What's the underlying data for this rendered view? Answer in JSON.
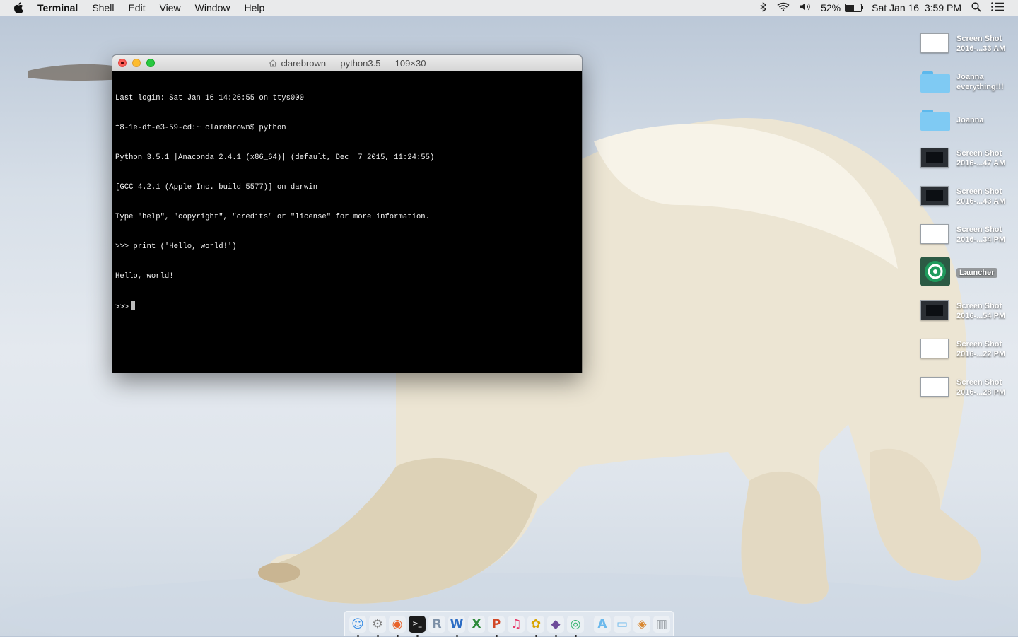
{
  "menubar": {
    "app_name": "Terminal",
    "menus": [
      "Shell",
      "Edit",
      "View",
      "Window",
      "Help"
    ],
    "battery_percent": "52%",
    "battery_level": 0.52,
    "datetime": "Sat Jan 16  3:59 PM",
    "icons": [
      "apple-icon",
      "bluetooth-icon",
      "wifi-icon",
      "volume-icon",
      "battery-icon",
      "spotlight-icon",
      "notification-center-icon"
    ]
  },
  "terminal": {
    "title": "clarebrown — python3.5 — 109×30",
    "lines": [
      "Last login: Sat Jan 16 14:26:55 on ttys000",
      "f8-1e-df-e3-59-cd:~ clarebrown$ python",
      "Python 3.5.1 |Anaconda 2.4.1 (x86_64)| (default, Dec  7 2015, 11:24:55)",
      "[GCC 4.2.1 (Apple Inc. build 5577)] on darwin",
      "Type \"help\", \"copyright\", \"credits\" or \"license\" for more information.",
      ">>> print ('Hello, world!')",
      "Hello, world!"
    ],
    "prompt": ">>>"
  },
  "desktop": {
    "items": [
      {
        "line1": "Screen Shot",
        "line2": "2016-...33 AM",
        "kind": "screenshot-light"
      },
      {
        "line1": "Joanna",
        "line2": "everything!!!",
        "kind": "folder"
      },
      {
        "line1": "Joanna",
        "line2": "",
        "kind": "folder"
      },
      {
        "line1": "Screen Shot",
        "line2": "2016-...47 AM",
        "kind": "screenshot-dark"
      },
      {
        "line1": "Screen Shot",
        "line2": "2016-...43 AM",
        "kind": "screenshot-dark"
      },
      {
        "line1": "Screen Shot",
        "line2": "2016-...34 PM",
        "kind": "screenshot-light"
      },
      {
        "line1": "Launcher",
        "line2": "",
        "kind": "app"
      },
      {
        "line1": "Screen Shot",
        "line2": "2016-...54 PM",
        "kind": "screenshot-dark"
      },
      {
        "line1": "Screen Shot",
        "line2": "2016-...22 PM",
        "kind": "screenshot-light"
      },
      {
        "line1": "Screen Shot",
        "line2": "2016-...28 PM",
        "kind": "screenshot-light"
      }
    ]
  },
  "dock": {
    "apps": [
      {
        "name": "finder-icon",
        "glyph": "☺",
        "color": "#3a8ee6"
      },
      {
        "name": "system-preferences-icon",
        "glyph": "⚙",
        "color": "#7d7d7d"
      },
      {
        "name": "firefox-icon",
        "glyph": "◉",
        "color": "#e8622a"
      },
      {
        "name": "terminal-icon",
        "glyph": ">_",
        "color": "#222222"
      },
      {
        "name": "r-icon",
        "glyph": "R",
        "color": "#7b8fa6"
      },
      {
        "name": "word-icon",
        "glyph": "W",
        "color": "#2b6cc4"
      },
      {
        "name": "excel-icon",
        "glyph": "X",
        "color": "#2e8b3c"
      },
      {
        "name": "powerpoint-icon",
        "glyph": "P",
        "color": "#d24726"
      },
      {
        "name": "itunes-icon",
        "glyph": "♫",
        "color": "#e63a6b"
      },
      {
        "name": "wing-ide-icon",
        "glyph": "✿",
        "color": "#d9a400"
      },
      {
        "name": "github-icon",
        "glyph": "◆",
        "color": "#6e4c9a"
      },
      {
        "name": "launcher-icon",
        "glyph": "◎",
        "color": "#2fb36b"
      }
    ],
    "stacks": [
      {
        "name": "applications-folder-icon",
        "glyph": "A",
        "color": "#6cb9ec"
      },
      {
        "name": "documents-folder-icon",
        "glyph": "▭",
        "color": "#6cb9ec"
      },
      {
        "name": "downloads-stack-icon",
        "glyph": "◈",
        "color": "#d8862e"
      },
      {
        "name": "trash-icon",
        "glyph": "▥",
        "color": "#9aa0a6"
      }
    ]
  }
}
